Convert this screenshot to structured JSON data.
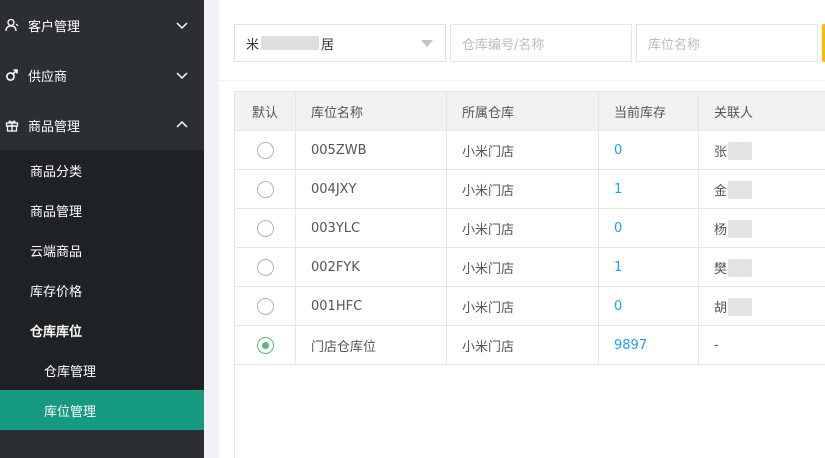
{
  "sidebar": {
    "groups": [
      {
        "label": "客户管理",
        "icon": "user-icon",
        "expanded": false
      },
      {
        "label": "供应商",
        "icon": "male-icon",
        "expanded": false
      },
      {
        "label": "商品管理",
        "icon": "gift-icon",
        "expanded": true
      }
    ],
    "sub_items": [
      {
        "label": "商品分类"
      },
      {
        "label": "商品管理"
      },
      {
        "label": "云端商品"
      },
      {
        "label": "库存价格"
      },
      {
        "label": "仓库库位"
      }
    ],
    "subsub_items": [
      {
        "label": "仓库管理",
        "active": false
      },
      {
        "label": "库位管理",
        "active": true
      }
    ]
  },
  "filters": {
    "store_select": {
      "prefix": "米",
      "suffix": "居"
    },
    "warehouse_placeholder": "仓库编号/名称",
    "location_placeholder": "库位名称"
  },
  "table": {
    "headers": [
      "默认",
      "库位名称",
      "所属仓库",
      "当前库存",
      "关联人"
    ],
    "rows": [
      {
        "default": false,
        "name": "005ZWB",
        "warehouse": "小米门店",
        "stock": "0",
        "contact": "张"
      },
      {
        "default": false,
        "name": "004JXY",
        "warehouse": "小米门店",
        "stock": "1",
        "contact": "金"
      },
      {
        "default": false,
        "name": "003YLC",
        "warehouse": "小米门店",
        "stock": "0",
        "contact": "杨"
      },
      {
        "default": false,
        "name": "002FYK",
        "warehouse": "小米门店",
        "stock": "1",
        "contact": "樊"
      },
      {
        "default": false,
        "name": "001HFC",
        "warehouse": "小米门店",
        "stock": "0",
        "contact": "胡"
      },
      {
        "default": true,
        "name": "门店仓库位",
        "warehouse": "小米门店",
        "stock": "9897",
        "contact": "-"
      }
    ]
  },
  "colors": {
    "sidebar_bg": "#2b2f33",
    "submenu_bg": "#1f2224",
    "active_item": "#169a82",
    "link_number": "#1e9fff",
    "radio_checked": "#5fb878",
    "search_button": "#ffb800"
  }
}
